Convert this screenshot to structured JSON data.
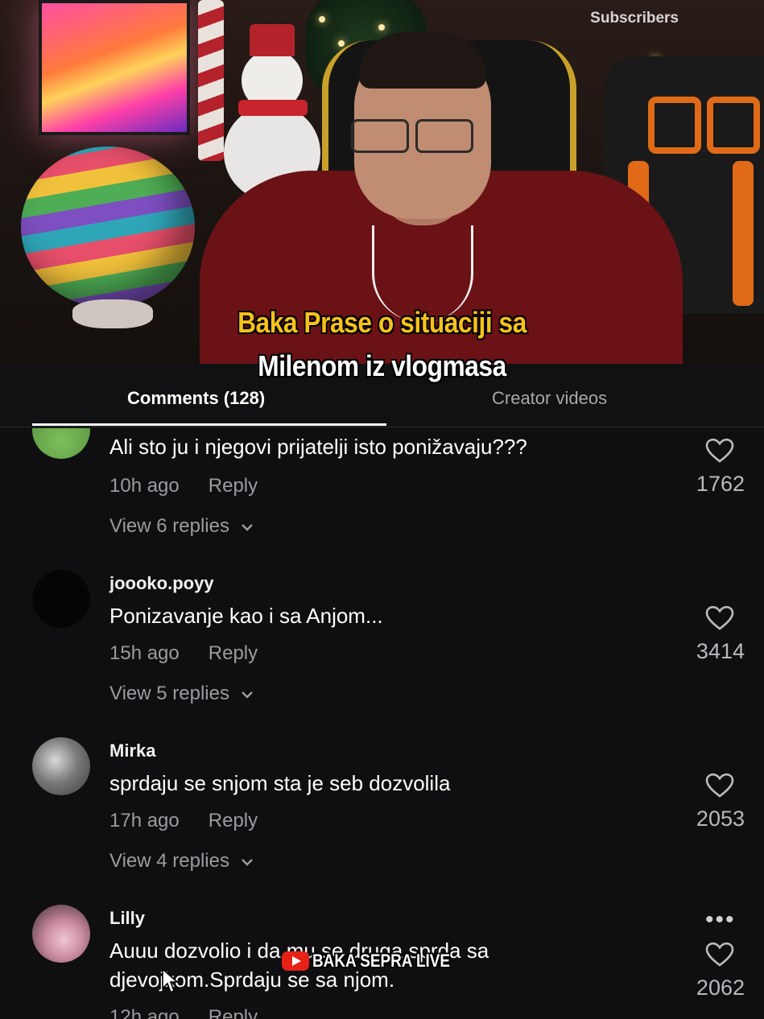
{
  "video": {
    "subscribers_label": "Subscribers",
    "caption_line1": "Baka Prase o situaciji sa",
    "caption_line2": "Milenom iz vlogmasa",
    "caption_color_1": "#f5c21b",
    "caption_color_2": "#ffffff"
  },
  "tabs": {
    "comments_label": "Comments (128)",
    "creator_label": "Creator videos"
  },
  "comments": [
    {
      "username": "",
      "text": "Ali sto ju i njegovi prijatelji isto ponižavaju???",
      "time": "10h ago",
      "reply_label": "Reply",
      "likes": "1762",
      "view_replies": "View 6 replies"
    },
    {
      "username": "joooko.poyy",
      "text": "Ponizavanje kao i sa Anjom...",
      "time": "15h ago",
      "reply_label": "Reply",
      "likes": "3414",
      "view_replies": "View 5 replies"
    },
    {
      "username": "Mirka",
      "text": "sprdaju se snjom sta je seb dozvolila",
      "time": "17h ago",
      "reply_label": "Reply",
      "likes": "2053",
      "view_replies": "View 4 replies"
    },
    {
      "username": "Lilly",
      "text_line1": "Auuu dozvolio i da mu se druga sprda sa",
      "text_line2": "djevojkom.Sprdaju se sa njom.",
      "time": "12h ago",
      "reply_label": "Reply",
      "likes": "2062",
      "more": "•••"
    }
  ],
  "watermark": {
    "text": "BAKA SEPRA LIVE",
    "icon": "youtube-icon"
  },
  "icons": {
    "like": "heart-icon",
    "expand": "chevron-down-icon"
  }
}
